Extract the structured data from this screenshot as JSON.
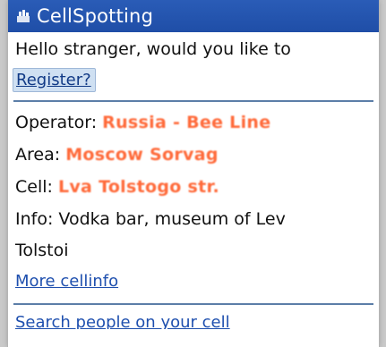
{
  "app": {
    "title": "CellSpotting",
    "icon": "cellspotting-app-icon"
  },
  "greeting": {
    "text": "Hello stranger, would you like to",
    "register_label": "Register?"
  },
  "cellinfo": {
    "operator": {
      "label": "Operator:",
      "value": "Russia - Bee Line"
    },
    "area": {
      "label": "Area:",
      "value": "Moscow Sorvag"
    },
    "cell": {
      "label": "Cell:",
      "value": "Lva Tolstogo str."
    },
    "info": {
      "label": "Info:",
      "value_line1": "Vodka bar, museum of Lev",
      "value_line2": "Tolstoi"
    },
    "more_label": "More cellinfo"
  },
  "bottom": {
    "partial_link": "Search people on your cell"
  },
  "colors": {
    "titlebar": "#1f4ea7",
    "link": "#1e4fae",
    "redacted_value": "#ff6a3a",
    "divider": "#5c7ea8"
  }
}
